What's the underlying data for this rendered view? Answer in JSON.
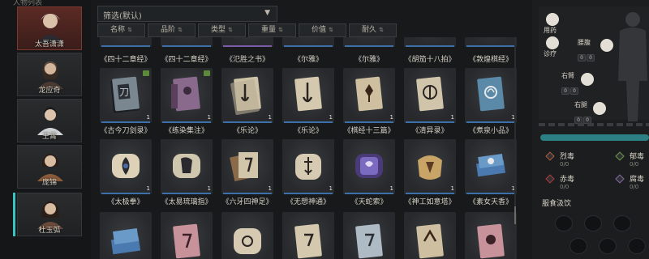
{
  "left_column": {
    "title": "人物列表",
    "characters": [
      {
        "name": "太吾潇潇",
        "selected": true
      },
      {
        "name": "龙应奇",
        "selected": false
      },
      {
        "name": "王霄",
        "selected": false
      },
      {
        "name": "庞锦",
        "selected": false
      },
      {
        "name": "杜玉弧",
        "selected": false
      }
    ]
  },
  "filter": {
    "selected": "筛选(默认)",
    "caret_icon": "chevron-down-icon"
  },
  "sort_buttons": [
    "名称",
    "品阶",
    "类型",
    "重量",
    "价值",
    "耐久"
  ],
  "items": {
    "row0": [
      {
        "label": "《四十二章经》",
        "bar": "blue"
      },
      {
        "label": "《四十二章经》",
        "bar": "blue"
      },
      {
        "label": "《氾胜之书》",
        "bar": "purple"
      },
      {
        "label": "《尔雅》",
        "bar": "blue"
      },
      {
        "label": "《尔雅》",
        "bar": "blue"
      },
      {
        "label": "《胡笳十八拍》",
        "bar": "blue"
      },
      {
        "label": "《敦煌棋经》",
        "bar": "blue"
      }
    ],
    "row1": [
      {
        "label": "《古今刀剑录》",
        "qty": "1",
        "badge": true,
        "bar": "blue"
      },
      {
        "label": "《练染集注》",
        "qty": "1",
        "badge": true,
        "bar": "blue"
      },
      {
        "label": "《乐论》",
        "qty": "1",
        "badge": false,
        "bar": "blue"
      },
      {
        "label": "《乐论》",
        "qty": "1",
        "badge": false,
        "bar": "blue"
      },
      {
        "label": "《棋经十三篇》",
        "qty": "1",
        "badge": false,
        "bar": "blue"
      },
      {
        "label": "《清异录》",
        "qty": "1",
        "badge": false,
        "bar": "blue"
      },
      {
        "label": "《煮泉小品》",
        "qty": "1",
        "badge": false,
        "bar": "blue"
      }
    ],
    "row2": [
      {
        "label": "《太极拳》",
        "qty": "1",
        "bar": "blue"
      },
      {
        "label": "《太易琉璃指》",
        "qty": "1",
        "bar": "blue"
      },
      {
        "label": "《六牙四神足》",
        "qty": "1",
        "bar": "blue"
      },
      {
        "label": "《无想神通》",
        "qty": "1",
        "bar": "blue"
      },
      {
        "label": "《天蛇索》",
        "qty": "1",
        "bar": "blue"
      },
      {
        "label": "《神工如意塔》",
        "qty": "1",
        "bar": "blue"
      },
      {
        "label": "《素女天香》",
        "qty": "1",
        "bar": "blue"
      }
    ],
    "row3": [
      {
        "qty": ""
      },
      {
        "qty": ""
      },
      {
        "qty": ""
      },
      {
        "qty": ""
      },
      {
        "qty": ""
      },
      {
        "qty": ""
      },
      {
        "qty": ""
      }
    ]
  },
  "body_panel": {
    "use_medicine": "用药",
    "treatment": "诊疗",
    "parts": [
      {
        "name": "腰腹",
        "slots": [
          "0",
          "0"
        ]
      },
      {
        "name": "右臂",
        "slots": [
          "0",
          "0"
        ]
      },
      {
        "name": "右腿",
        "slots": [
          "0",
          "0"
        ]
      }
    ]
  },
  "poisons": [
    {
      "name": "烈毒",
      "values": "0/0"
    },
    {
      "name": "郁毒",
      "values": "0/0"
    },
    {
      "name": "赤毒",
      "values": "0/0"
    },
    {
      "name": "腐毒",
      "values": "0/0"
    }
  ],
  "food": {
    "title": "服食汲饮"
  },
  "colors": {
    "accent_teal": "#38c4c0",
    "rarity_blue": "#3d6fa8",
    "rarity_purple": "#7c5ba8",
    "selected_red": "#5b2a24"
  }
}
